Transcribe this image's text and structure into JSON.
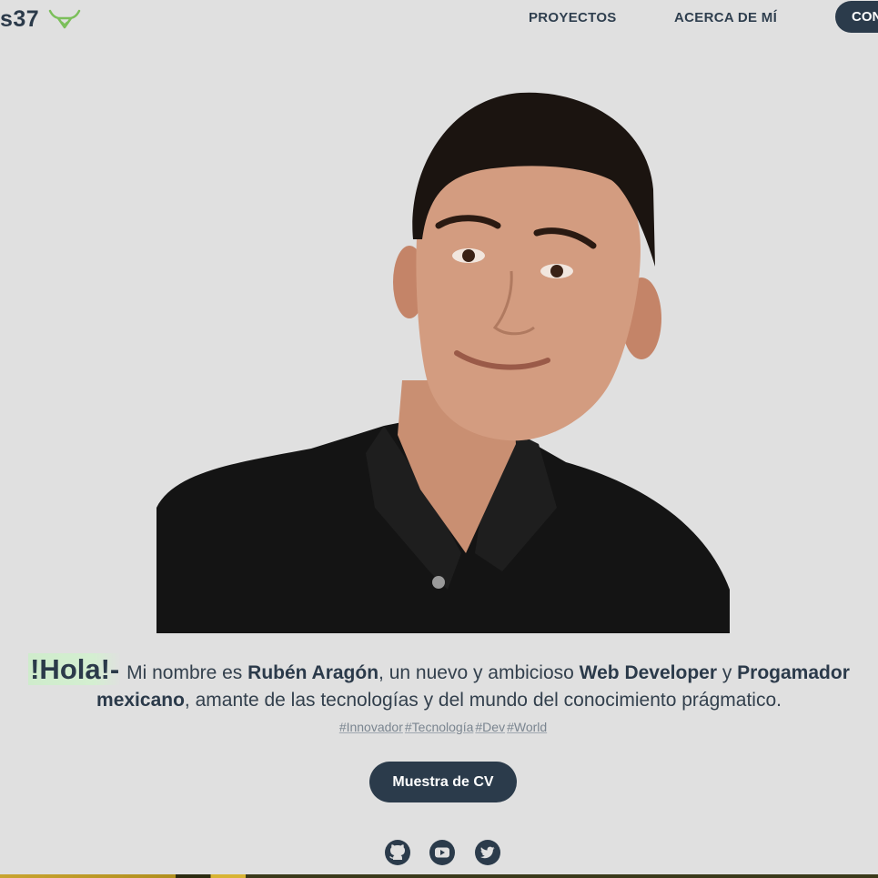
{
  "header": {
    "logo_text": "s37",
    "logo_icon": "bull-horns-icon",
    "nav": {
      "projects": "PROYECTOS",
      "about": "ACERCA DE MÍ",
      "contact": "CON"
    }
  },
  "hero": {
    "photo_alt": "portrait-photo"
  },
  "intro": {
    "hola": "!Hola!-",
    "p1": " Mi nombre es ",
    "name": "Rubén Aragón",
    "p2": ", un nuevo y ambicioso ",
    "role1": "Web Developer",
    "p3": " y ",
    "role2": "Progamador mexicano",
    "p4": ", amante de las tecnologías y del mundo del conocimiento prágmatico."
  },
  "tags": [
    "#Innovador",
    "#Tecnología",
    "#Dev",
    "#World"
  ],
  "cv_button": "Muestra de CV",
  "social": {
    "icons": [
      "github-icon",
      "youtube-icon",
      "twitter-icon"
    ]
  },
  "colors": {
    "background": "#e0e0e0",
    "primary_dark": "#2b3b4b",
    "accent_green": "#7bbf5a",
    "highlight": "#cfeccc"
  }
}
